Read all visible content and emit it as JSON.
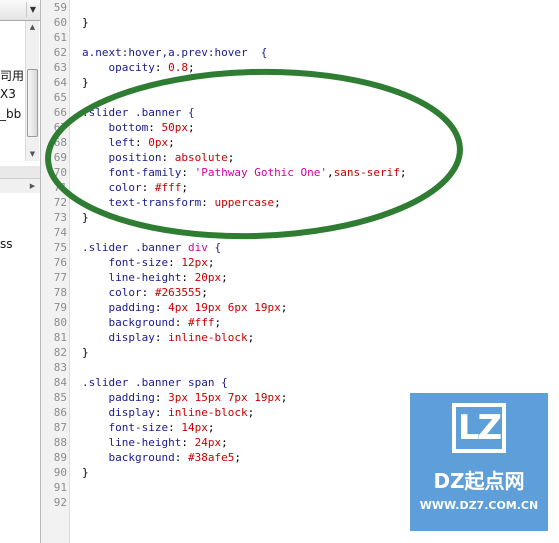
{
  "sidebar": {
    "tree_fragments": [
      "司用相",
      "X3",
      "_bb"
    ],
    "panel_fragment": "ss"
  },
  "editor": {
    "colors": {
      "selector": "#1a1a8c",
      "property": "#1a1a8c",
      "value": "#c80000",
      "string": "#d400a0",
      "line_number": "#8c8c8c",
      "gutter_bg": "#f2f2f2"
    },
    "lines": [
      {
        "n": "59",
        "tokens": []
      },
      {
        "n": "60",
        "tokens": [
          {
            "t": "}",
            "c": "punct"
          }
        ]
      },
      {
        "n": "61",
        "tokens": []
      },
      {
        "n": "62",
        "tokens": [
          {
            "t": "a.next:hover,a.prev:hover  {",
            "c": "sel"
          }
        ]
      },
      {
        "n": "63",
        "tokens": [
          {
            "t": "    opacity",
            "c": "prop"
          },
          {
            "t": ": ",
            "c": "punct"
          },
          {
            "t": "0.8",
            "c": "val"
          },
          {
            "t": ";",
            "c": "punct"
          }
        ]
      },
      {
        "n": "64",
        "tokens": [
          {
            "t": "}",
            "c": "punct"
          }
        ]
      },
      {
        "n": "65",
        "tokens": []
      },
      {
        "n": "66",
        "tokens": [
          {
            "t": ".slider .banner {",
            "c": "sel"
          }
        ]
      },
      {
        "n": "67",
        "tokens": [
          {
            "t": "    bottom",
            "c": "prop"
          },
          {
            "t": ": ",
            "c": "punct"
          },
          {
            "t": "50px",
            "c": "val"
          },
          {
            "t": ";",
            "c": "punct"
          }
        ]
      },
      {
        "n": "68",
        "tokens": [
          {
            "t": "    left",
            "c": "prop"
          },
          {
            "t": ": ",
            "c": "punct"
          },
          {
            "t": "0px",
            "c": "val"
          },
          {
            "t": ";",
            "c": "punct"
          }
        ]
      },
      {
        "n": "69",
        "tokens": [
          {
            "t": "    position",
            "c": "prop"
          },
          {
            "t": ": ",
            "c": "punct"
          },
          {
            "t": "absolute",
            "c": "val"
          },
          {
            "t": ";",
            "c": "punct"
          }
        ]
      },
      {
        "n": "70",
        "tokens": [
          {
            "t": "    font-family",
            "c": "prop"
          },
          {
            "t": ": ",
            "c": "punct"
          },
          {
            "t": "'Pathway Gothic One'",
            "c": "str"
          },
          {
            "t": ",",
            "c": "punct"
          },
          {
            "t": "sans-serif",
            "c": "val"
          },
          {
            "t": ";",
            "c": "punct"
          }
        ]
      },
      {
        "n": "71",
        "tokens": [
          {
            "t": "    color",
            "c": "prop"
          },
          {
            "t": ": ",
            "c": "punct"
          },
          {
            "t": "#fff",
            "c": "val"
          },
          {
            "t": ";",
            "c": "punct"
          }
        ]
      },
      {
        "n": "72",
        "tokens": [
          {
            "t": "    text-transform",
            "c": "prop"
          },
          {
            "t": ": ",
            "c": "punct"
          },
          {
            "t": "uppercase",
            "c": "val"
          },
          {
            "t": ";",
            "c": "punct"
          }
        ]
      },
      {
        "n": "73",
        "tokens": [
          {
            "t": "}",
            "c": "punct"
          }
        ]
      },
      {
        "n": "74",
        "tokens": []
      },
      {
        "n": "75",
        "tokens": [
          {
            "t": ".slider .banner ",
            "c": "sel"
          },
          {
            "t": "div",
            "c": "str"
          },
          {
            "t": " {",
            "c": "sel"
          }
        ]
      },
      {
        "n": "76",
        "tokens": [
          {
            "t": "    font-size",
            "c": "prop"
          },
          {
            "t": ": ",
            "c": "punct"
          },
          {
            "t": "12px",
            "c": "val"
          },
          {
            "t": ";",
            "c": "punct"
          }
        ]
      },
      {
        "n": "77",
        "tokens": [
          {
            "t": "    line-height",
            "c": "prop"
          },
          {
            "t": ": ",
            "c": "punct"
          },
          {
            "t": "20px",
            "c": "val"
          },
          {
            "t": ";",
            "c": "punct"
          }
        ]
      },
      {
        "n": "78",
        "tokens": [
          {
            "t": "    color",
            "c": "prop"
          },
          {
            "t": ": ",
            "c": "punct"
          },
          {
            "t": "#263555",
            "c": "val"
          },
          {
            "t": ";",
            "c": "punct"
          }
        ]
      },
      {
        "n": "79",
        "tokens": [
          {
            "t": "    padding",
            "c": "prop"
          },
          {
            "t": ": ",
            "c": "punct"
          },
          {
            "t": "4px 19px 6px 19px",
            "c": "val"
          },
          {
            "t": ";",
            "c": "punct"
          }
        ]
      },
      {
        "n": "80",
        "tokens": [
          {
            "t": "    background",
            "c": "prop"
          },
          {
            "t": ": ",
            "c": "punct"
          },
          {
            "t": "#fff",
            "c": "val"
          },
          {
            "t": ";",
            "c": "punct"
          }
        ]
      },
      {
        "n": "81",
        "tokens": [
          {
            "t": "    display",
            "c": "prop"
          },
          {
            "t": ": ",
            "c": "punct"
          },
          {
            "t": "inline-block",
            "c": "val"
          },
          {
            "t": ";",
            "c": "punct"
          }
        ]
      },
      {
        "n": "82",
        "tokens": [
          {
            "t": "}",
            "c": "punct"
          }
        ]
      },
      {
        "n": "83",
        "tokens": []
      },
      {
        "n": "84",
        "tokens": [
          {
            "t": ".slider .banner span {",
            "c": "sel"
          }
        ]
      },
      {
        "n": "85",
        "tokens": [
          {
            "t": "    padding",
            "c": "prop"
          },
          {
            "t": ": ",
            "c": "punct"
          },
          {
            "t": "3px 15px 7px 19px",
            "c": "val"
          },
          {
            "t": ";",
            "c": "punct"
          }
        ]
      },
      {
        "n": "86",
        "tokens": [
          {
            "t": "    display",
            "c": "prop"
          },
          {
            "t": ": ",
            "c": "punct"
          },
          {
            "t": "inline-block",
            "c": "val"
          },
          {
            "t": ";",
            "c": "punct"
          }
        ]
      },
      {
        "n": "87",
        "tokens": [
          {
            "t": "    font-size",
            "c": "prop"
          },
          {
            "t": ": ",
            "c": "punct"
          },
          {
            "t": "14px",
            "c": "val"
          },
          {
            "t": ";",
            "c": "punct"
          }
        ]
      },
      {
        "n": "88",
        "tokens": [
          {
            "t": "    line-height",
            "c": "prop"
          },
          {
            "t": ": ",
            "c": "punct"
          },
          {
            "t": "24px",
            "c": "val"
          },
          {
            "t": ";",
            "c": "punct"
          }
        ]
      },
      {
        "n": "89",
        "tokens": [
          {
            "t": "    background",
            "c": "prop"
          },
          {
            "t": ": ",
            "c": "punct"
          },
          {
            "t": "#38afe5",
            "c": "val"
          },
          {
            "t": ";",
            "c": "punct"
          }
        ]
      },
      {
        "n": "90",
        "tokens": [
          {
            "t": "}",
            "c": "punct"
          }
        ]
      },
      {
        "n": "91",
        "tokens": []
      },
      {
        "n": "92",
        "tokens": []
      }
    ]
  },
  "annotation": {
    "color": "#2e7d32",
    "shape": "ellipse-outline"
  },
  "watermark": {
    "mark": "LZ",
    "name": "DZ起点网",
    "url": "WWW.DZ7.COM.CN",
    "bg_color": "#5e9fda"
  }
}
